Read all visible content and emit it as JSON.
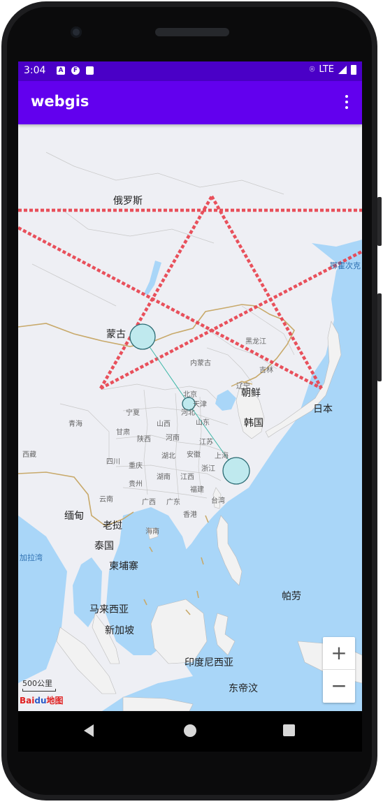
{
  "status_bar": {
    "time": "3:04",
    "network": "LTE",
    "icons": [
      "a-icon",
      "f-icon",
      "sd-card-icon",
      "location-icon",
      "signal-icon",
      "battery-icon"
    ]
  },
  "app_bar": {
    "title": "webgis",
    "menu_icon": "more-vert-icon"
  },
  "map": {
    "labels": {
      "russia": "俄罗斯",
      "mongolia": "蒙古",
      "heilongjiang": "黑龙江",
      "neimenggu": "内蒙古",
      "jilin": "吉林",
      "liaoning": "辽宁",
      "north_korea": "朝鲜",
      "south_korea": "韩国",
      "japan": "日本",
      "beijing": "北京",
      "tianjin": "天津",
      "hebei": "河北",
      "shandong": "山东",
      "shanxi": "山西",
      "henan": "河南",
      "qinghai": "青海",
      "gansu": "甘肃",
      "shaanxi": "陕西",
      "ningxia": "宁夏",
      "xizang": "西藏",
      "sichuan": "四川",
      "chongqing": "重庆",
      "hubei": "湖北",
      "anhui": "安徽",
      "jiangsu": "江苏",
      "shanghai": "上海",
      "zhejiang": "浙江",
      "hunan": "湖南",
      "jiangxi": "江西",
      "guizhou": "贵州",
      "fujian": "福建",
      "yunnan": "云南",
      "guangxi": "广西",
      "guangdong": "广东",
      "hongkong": "香港",
      "taiwan": "台湾",
      "hainan": "海南",
      "myanmar": "缅甸",
      "laos": "老挝",
      "thailand": "泰国",
      "cambodia": "柬埔寨",
      "malaysia": "马来西亚",
      "singapore": "新加坡",
      "indonesia": "印度尼西亚",
      "philippines": "帕劳",
      "timor": "东帝汶",
      "bay_of_bengal": "加拉湾",
      "okhotsk": "鄂霍次克"
    },
    "scale": "500公里",
    "logo": {
      "bai": "Bai",
      "du": "du",
      "map": "地图"
    },
    "zoom_in": "+",
    "zoom_out": "−"
  },
  "colors": {
    "status_bar": "#4a00c7",
    "app_bar": "#6200ee",
    "land": "#eeeff4",
    "sea": "#a9d6f8",
    "star_line": "#e8434f",
    "marker": "#bfe9ee"
  }
}
